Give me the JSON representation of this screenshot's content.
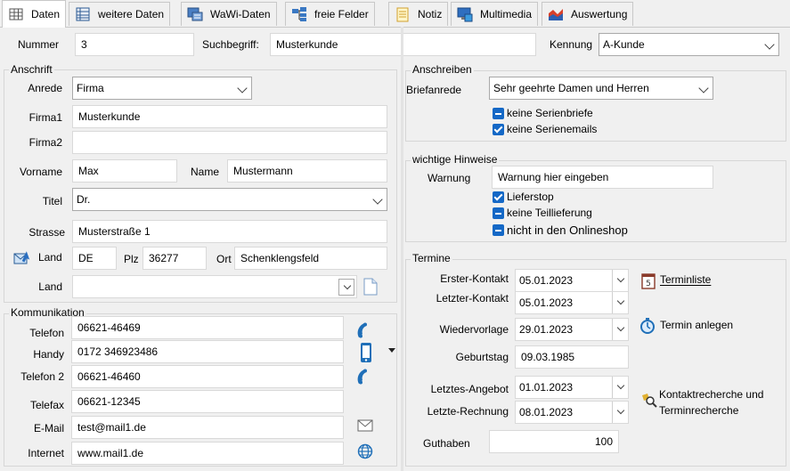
{
  "tabs": [
    {
      "label": "Daten",
      "icon": "grid-icon"
    },
    {
      "label": "weitere Daten",
      "icon": "table-icon"
    },
    {
      "label": "WaWi-Daten",
      "icon": "wawi-icon"
    },
    {
      "label": "freie Felder",
      "icon": "fields-icon"
    },
    {
      "label": "Notiz",
      "icon": "note-icon"
    },
    {
      "label": "Multimedia",
      "icon": "multimedia-icon"
    },
    {
      "label": "Auswertung",
      "icon": "chart-icon"
    }
  ],
  "top": {
    "nummer_label": "Nummer",
    "nummer_value": "3",
    "suchbegriff_label": "Suchbegriff:",
    "suchbegriff_value": "Musterkunde",
    "kennung_label": "Kennung",
    "kennung_value": "A-Kunde"
  },
  "anschrift": {
    "title": "Anschrift",
    "anrede_label": "Anrede",
    "anrede_value": "Firma",
    "firma1_label": "Firma1",
    "firma1_value": "Musterkunde",
    "firma2_label": "Firma2",
    "firma2_value": "",
    "vorname_label": "Vorname",
    "vorname_value": "Max",
    "name_label": "Name",
    "name_value": "Mustermann",
    "titel_label": "Titel",
    "titel_value": "Dr.",
    "strasse_label": "Strasse",
    "strasse_value": "Musterstraße 1",
    "land_label": "Land",
    "land_value": "DE",
    "plz_label": "Plz",
    "plz_value": "36277",
    "ort_label": "Ort",
    "ort_value": "Schenklengsfeld",
    "land2_label": "Land",
    "land2_value": ""
  },
  "kommunikation": {
    "title": "Kommunikation",
    "telefon_label": "Telefon",
    "telefon_value": "06621-46469",
    "handy_label": "Handy",
    "handy_value": "0172 346923486",
    "telefon2_label": "Telefon 2",
    "telefon2_value": "06621-46460",
    "telefax_label": "Telefax",
    "telefax_value": "06621-12345",
    "email_label": "E-Mail",
    "email_value": "test@mail1.de",
    "internet_label": "Internet",
    "internet_value": "www.mail1.de"
  },
  "anschreiben": {
    "title": "Anschreiben",
    "briefanrede_label": "Briefanrede",
    "briefanrede_value": "Sehr geehrte Damen und Herren",
    "serienbriefe_label": "keine Serienbriefe",
    "serienbriefe_state": "indeterminate",
    "serienemails_label": "keine Serienemails",
    "serienemails_state": "checked"
  },
  "hinweise": {
    "title": "wichtige Hinweise",
    "warnung_label": "Warnung",
    "warnung_value": "Warnung hier eingeben",
    "lieferstop_label": "Lieferstop",
    "lieferstop_state": "checked",
    "teillieferung_label": "keine Teillieferung",
    "teillieferung_state": "indeterminate",
    "onlineshop_label": "nicht in den Onlineshop",
    "onlineshop_state": "indeterminate"
  },
  "termine": {
    "title": "Termine",
    "erster_label": "Erster-Kontakt",
    "erster_value": "05.01.2023",
    "letzter_label": "Letzter-Kontakt",
    "letzter_value": "05.01.2023",
    "wiedervorlage_label": "Wiedervorlage",
    "wiedervorlage_value": "29.01.2023",
    "geburtstag_label": "Geburtstag",
    "geburtstag_value": "09.03.1985",
    "angebot_label": "Letztes-Angebot",
    "angebot_value": "01.01.2023",
    "rechnung_label": "Letzte-Rechnung",
    "rechnung_value": "08.01.2023",
    "guthaben_label": "Guthaben",
    "guthaben_value": "100",
    "terminliste_label": "Terminliste",
    "termin_anlegen_label": "Termin anlegen",
    "recherche_line1": "Kontaktrecherche und",
    "recherche_line2": "Terminrecherche"
  },
  "colors": {
    "checkbox": "#1468c6",
    "phone_icon": "#1f6fb8",
    "accent": "#1468c6"
  }
}
